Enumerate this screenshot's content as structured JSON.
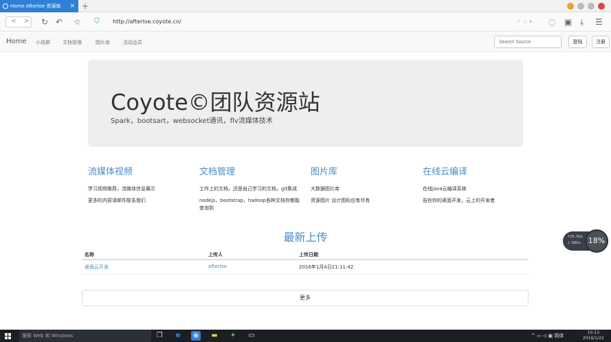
{
  "browser": {
    "tab_title": "Home Afterloe 资源库",
    "tab_close": "×",
    "new_tab": "+",
    "url": "http://afterloe.coyote.cn/",
    "nav_back": "<",
    "nav_forward": ">",
    "refresh": "↻",
    "undo": "↶",
    "favorite": "☆",
    "addr_right_icons": "⚡ ☆ ▾"
  },
  "site_nav": {
    "brand": "Home",
    "links": [
      "小视屏",
      "文档管理",
      "图片库",
      "活动会员"
    ],
    "search_placeholder": "Search Source",
    "login": "登陆",
    "register": "注册"
  },
  "jumbotron": {
    "title": "Coyote©团队资源站",
    "subtitle": "Spark，bootsart，websocket通讯，flv流媒体技术"
  },
  "features": [
    {
      "title": "流媒体视频",
      "lines": [
        "学习视频推荐，流媒体信息展示",
        "更多的内容请邮件联系我们"
      ]
    },
    {
      "title": "文档管理",
      "lines": [
        "工作上的文档，还是自己学习的文档，git集成",
        "nodejs，bootstrap，hadoop各种文档你都能查询到"
      ]
    },
    {
      "title": "图片库",
      "lines": [
        "大数据图片库",
        "资源图片 设计图标应有尽有"
      ]
    },
    {
      "title": "在线云编译",
      "lines": [
        "在线java云编译系统",
        "告别你的桌面开发，云上的开发者"
      ]
    }
  ],
  "uploads": {
    "title": "最新上传",
    "headers": [
      "名称",
      "上传人",
      "上传日期"
    ],
    "rows": [
      {
        "name": "桌面云开发",
        "uploader": "afterloe",
        "date": "2016年1月4日21:11:42"
      }
    ],
    "more": "更多"
  },
  "speed_widget": {
    "up": "↑25.7K/s",
    "down": "↓ 18K/s",
    "percent": "18%"
  },
  "taskbar": {
    "search_placeholder": "搜索 Web 和 Windows",
    "ime": "简体",
    "time": "10:13",
    "date": "2016/1/22"
  },
  "colors": {
    "tab_active": "#2f7fd6",
    "link_blue": "#4a8bc6",
    "jumbotron_bg": "#eeeeee",
    "taskbar_bg": "#1b1f24"
  }
}
